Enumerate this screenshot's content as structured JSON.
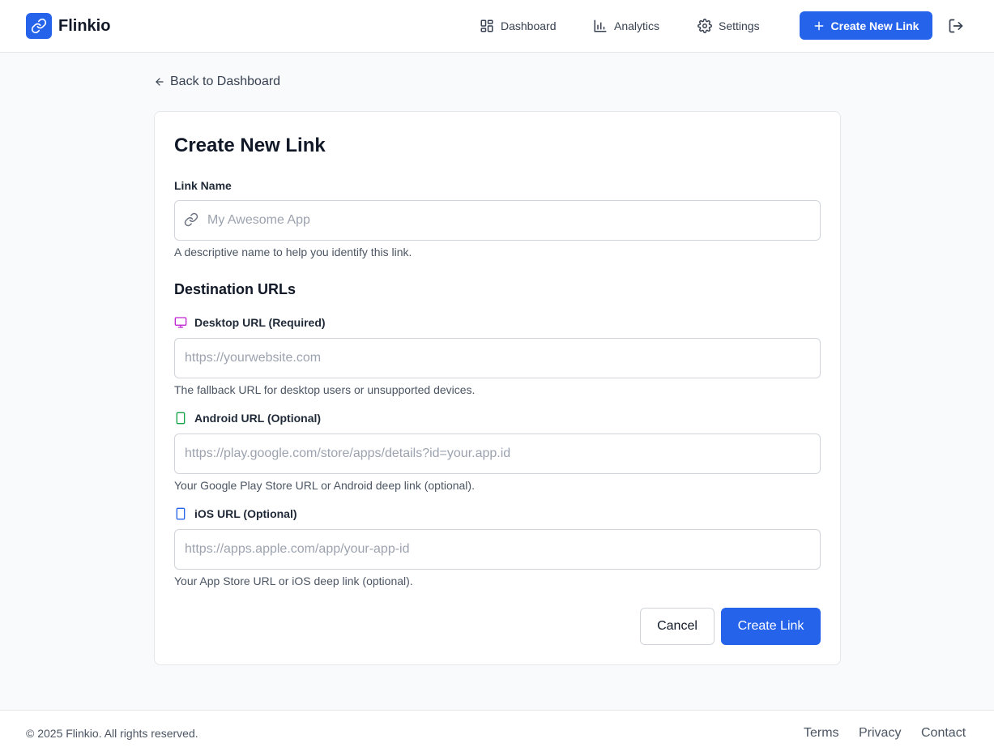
{
  "brand": {
    "name": "Flinkio",
    "accent": "#2563eb"
  },
  "header": {
    "nav": [
      {
        "label": "Dashboard",
        "icon": "dashboard-icon"
      },
      {
        "label": "Analytics",
        "icon": "bar-chart-icon"
      },
      {
        "label": "Settings",
        "icon": "gear-icon"
      }
    ],
    "create_button": "Create New Link",
    "logout_icon": "logout-icon"
  },
  "back_link": "Back to Dashboard",
  "form": {
    "title": "Create New Link",
    "link_name": {
      "label": "Link Name",
      "placeholder": "My Awesome App",
      "value": "",
      "help": "A descriptive name to help you identify this link."
    },
    "section_title": "Destination URLs",
    "desktop": {
      "label": "Desktop URL (Required)",
      "icon_color": "#c026d3",
      "placeholder": "https://yourwebsite.com",
      "value": "",
      "help": "The fallback URL for desktop users or unsupported devices."
    },
    "android": {
      "label": "Android URL (Optional)",
      "icon_color": "#16a34a",
      "placeholder": "https://play.google.com/store/apps/details?id=your.app.id",
      "value": "",
      "help": "Your Google Play Store URL or Android deep link (optional)."
    },
    "ios": {
      "label": "iOS URL (Optional)",
      "icon_color": "#2563eb",
      "placeholder": "https://apps.apple.com/app/your-app-id",
      "value": "",
      "help": "Your App Store URL or iOS deep link (optional)."
    },
    "cancel_label": "Cancel",
    "submit_label": "Create Link"
  },
  "footer": {
    "copyright": "© 2025 Flinkio. All rights reserved.",
    "links": [
      "Terms",
      "Privacy",
      "Contact"
    ]
  }
}
